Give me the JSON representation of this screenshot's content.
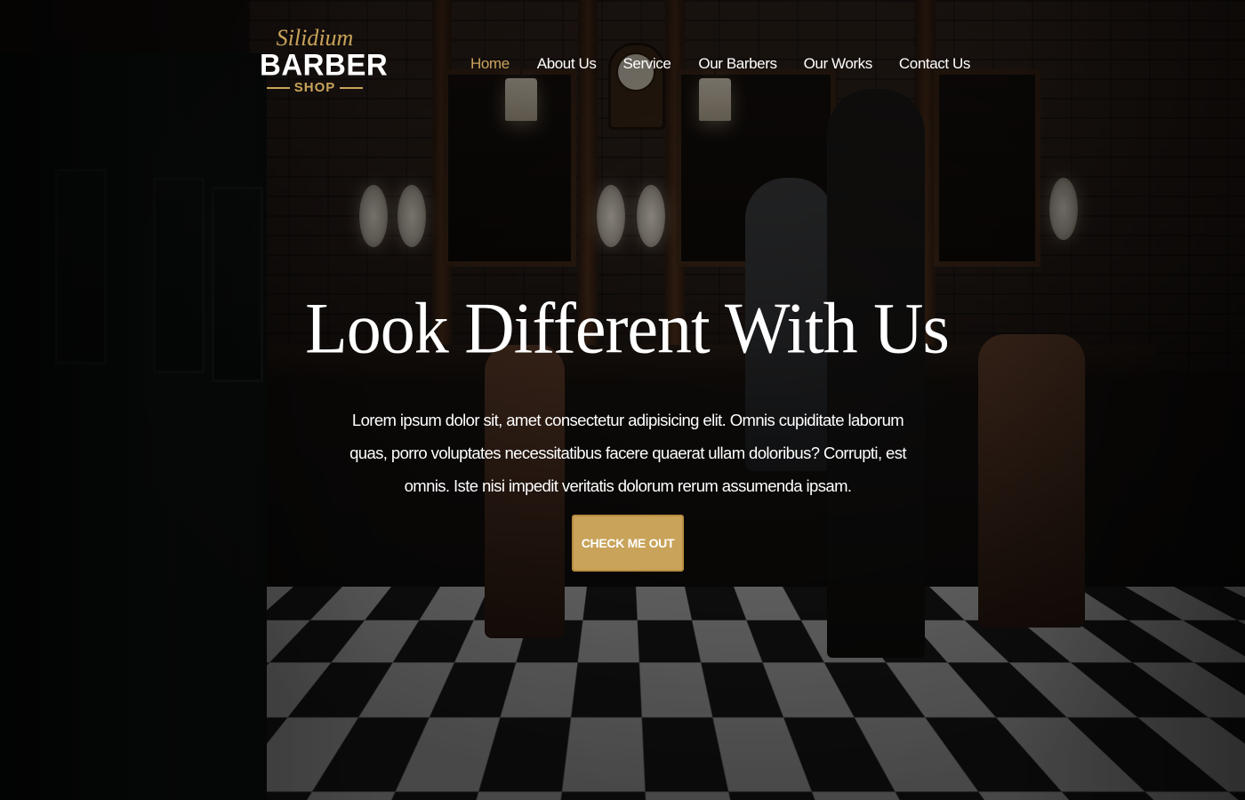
{
  "logo": {
    "script_text": "Silidium",
    "main_text": "BARBER",
    "sub_text": "SHOP"
  },
  "nav": {
    "items": [
      {
        "label": "Home",
        "active": true
      },
      {
        "label": "About Us",
        "active": false
      },
      {
        "label": "Service",
        "active": false
      },
      {
        "label": "Our Barbers",
        "active": false
      },
      {
        "label": "Our Works",
        "active": false
      },
      {
        "label": "Contact Us",
        "active": false
      }
    ]
  },
  "hero": {
    "headline": "Look Different With Us",
    "body": "Lorem ipsum dolor sit, amet consectetur adipisicing elit. Omnis cupiditate laborum quas, porro voluptates necessitatibus facere quaerat ullam doloribus? Corrupti, est omnis. Iste nisi impedit veritatis dolorum rerum assumenda ipsam.",
    "cta_label": "CHECK ME OUT"
  },
  "colors": {
    "accent": "#c9a35a",
    "text": "#ffffff",
    "background": "#0b0b0c"
  }
}
